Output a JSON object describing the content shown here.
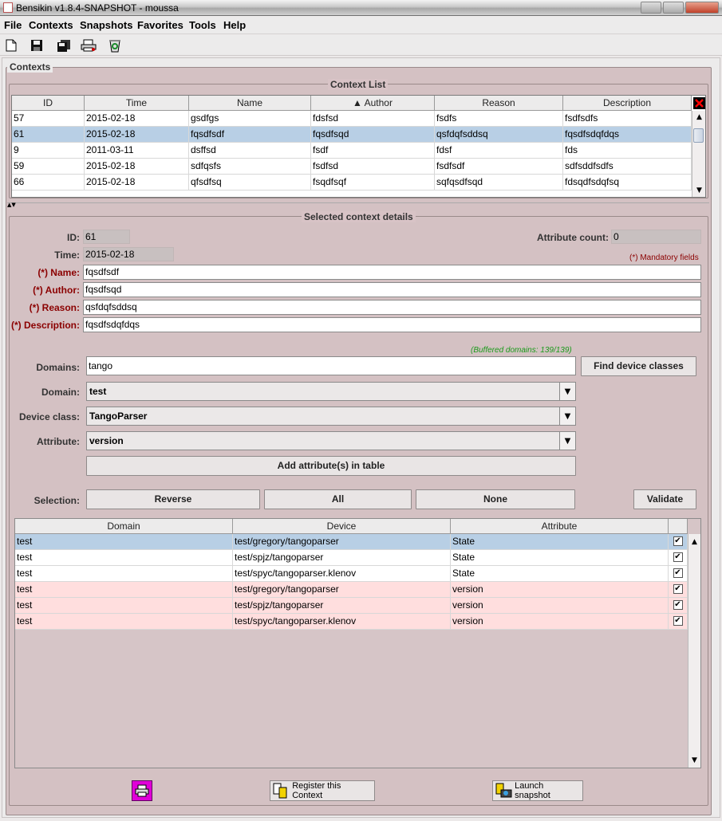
{
  "window": {
    "title": "Bensikin v1.8.4-SNAPSHOT - moussa"
  },
  "menu": [
    "File",
    "Contexts",
    "Snapshots",
    "Favorites",
    "Tools",
    "Help"
  ],
  "toolbar": {
    "icons": [
      "new-file-icon",
      "save-icon",
      "save-all-icon",
      "print-icon",
      "recycle-icon"
    ]
  },
  "contexts_panel": {
    "title": "Contexts"
  },
  "context_list": {
    "title": "Context List",
    "columns": [
      "ID",
      "Time",
      "Name",
      "Author",
      "Reason",
      "Description"
    ],
    "sorted_column": "Author",
    "rows": [
      [
        "57",
        "2015-02-18",
        "gsdfgs",
        "fdsfsd",
        "fsdfs",
        "fsdfsdfs"
      ],
      [
        "61",
        "2015-02-18",
        "fqsdfsdf",
        "fqsdfsqd",
        "qsfdqfsddsq",
        "fqsdfsdqfdqs"
      ],
      [
        "9",
        "2011-03-11",
        "dsffsd",
        "fsdf",
        "fdsf",
        "fds"
      ],
      [
        "59",
        "2015-02-18",
        "sdfqsfs",
        "fsdfsd",
        "fsdfsdf",
        "sdfsddfsdfs"
      ],
      [
        "66",
        "2015-02-18",
        "qfsdfsq",
        "fsqdfsqf",
        "sqfqsdfsqd",
        "fdsqdfsdqfsq"
      ]
    ],
    "selected_row": 1
  },
  "details": {
    "title": "Selected context details",
    "id_label": "ID:",
    "id_value": "61",
    "time_label": "Time:",
    "time_value": "2015-02-18",
    "attr_count_label": "Attribute count:",
    "attr_count_value": "0",
    "mandatory_note": "(*) Mandatory fields",
    "name_label": "(*) Name:",
    "name_value": "fqsdfsdf",
    "author_label": "(*) Author:",
    "author_value": "fqsdfsqd",
    "reason_label": "(*) Reason:",
    "reason_value": "qsfdqfsddsq",
    "description_label": "(*) Description:",
    "description_value": "fqsdfsdqfdqs",
    "buffered_domains": "(Buffered domains: 139/139)",
    "domains_label": "Domains:",
    "domains_value": "tango",
    "find_button": "Find device classes",
    "domain_label": "Domain:",
    "domain_value": "test",
    "device_class_label": "Device class:",
    "device_class_value": "TangoParser",
    "attribute_label": "Attribute:",
    "attribute_value": "version",
    "add_button": "Add attribute(s) in table",
    "selection_label": "Selection:",
    "reverse_button": "Reverse",
    "all_button": "All",
    "none_button": "None",
    "validate_button": "Validate"
  },
  "attribute_table": {
    "columns": [
      "Domain",
      "Device",
      "Attribute"
    ],
    "rows": [
      {
        "domain": "test",
        "device": "test/gregory/tangoparser",
        "attribute": "State",
        "checked": "✔",
        "style": "sel"
      },
      {
        "domain": "test",
        "device": "test/spjz/tangoparser",
        "attribute": "State",
        "checked": "✔",
        "style": ""
      },
      {
        "domain": "test",
        "device": "test/spyc/tangoparser.klenov",
        "attribute": "State",
        "checked": "✔",
        "style": ""
      },
      {
        "domain": "test",
        "device": "test/gregory/tangoparser",
        "attribute": "version",
        "checked": "✔",
        "style": "pink"
      },
      {
        "domain": "test",
        "device": "test/spjz/tangoparser",
        "attribute": "version",
        "checked": "✔",
        "style": "pink"
      },
      {
        "domain": "test",
        "device": "test/spyc/tangoparser.klenov",
        "attribute": "version",
        "checked": "✔",
        "style": "pink"
      }
    ]
  },
  "bottom": {
    "register_button": "Register this Context",
    "launch_button": "Launch snapshot"
  },
  "colors": {
    "panel": "#d4c1c3",
    "selected_row": "#b8cfe5",
    "pink_row": "#ffdede",
    "required": "#8b0000",
    "buffered": "#1a9a1a"
  }
}
